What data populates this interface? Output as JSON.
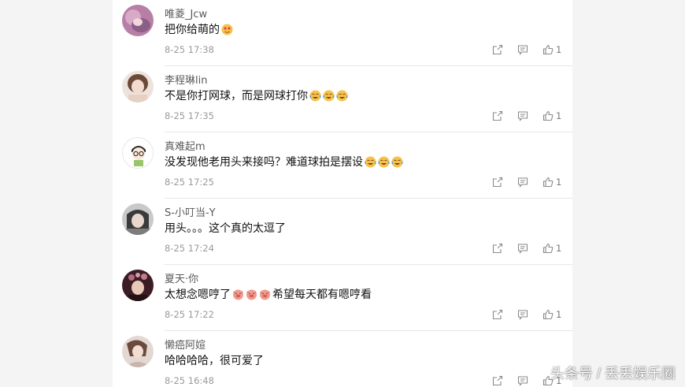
{
  "comments": [
    {
      "username": "唯菱_Jcw",
      "text": "把你给萌的",
      "emojis": [
        "love-face-emoji"
      ],
      "time": "8-25 17:38",
      "likes": "1",
      "avatar_color": "#c48fb0"
    },
    {
      "username": "李程琳lin",
      "text": "不是你打网球，而是网球打你",
      "emojis": [
        "laugh-cry-emoji",
        "laugh-cry-emoji",
        "laugh-cry-emoji"
      ],
      "time": "8-25 17:35",
      "likes": "1",
      "avatar_color": "#d9c7bd"
    },
    {
      "username": "真难起m",
      "text": "没发现他老用头来接吗？难道球拍是摆设",
      "emojis": [
        "laugh-cry-emoji",
        "laugh-cry-emoji",
        "laugh-cry-emoji"
      ],
      "time": "8-25 17:25",
      "likes": "1",
      "avatar_color": "#ffffff"
    },
    {
      "username": "S-小叮当-Y",
      "text": "用头。。。这个真的太逗了",
      "emojis": [],
      "time": "8-25 17:24",
      "likes": "1",
      "avatar_color": "#9a9a9a"
    },
    {
      "username": "夏天·你",
      "text_before": "太想念嗯哼了",
      "emojis": [
        "pig-face-emoji",
        "pig-face-emoji",
        "pig-face-emoji"
      ],
      "text_after": "希望每天都有嗯哼看",
      "time": "8-25 17:22",
      "likes": "1",
      "avatar_color": "#5b2b38"
    },
    {
      "username": "懒癌阿媗",
      "text": "哈哈哈哈，很可爱了",
      "emojis": [],
      "time": "8-25 16:48",
      "likes": "1",
      "avatar_color": "#d8c9c2"
    }
  ],
  "icons": {
    "share": "share-icon",
    "reply": "reply-icon",
    "like": "thumbs-up-icon"
  },
  "watermark": "头条号 / 丢丢娱乐圈"
}
